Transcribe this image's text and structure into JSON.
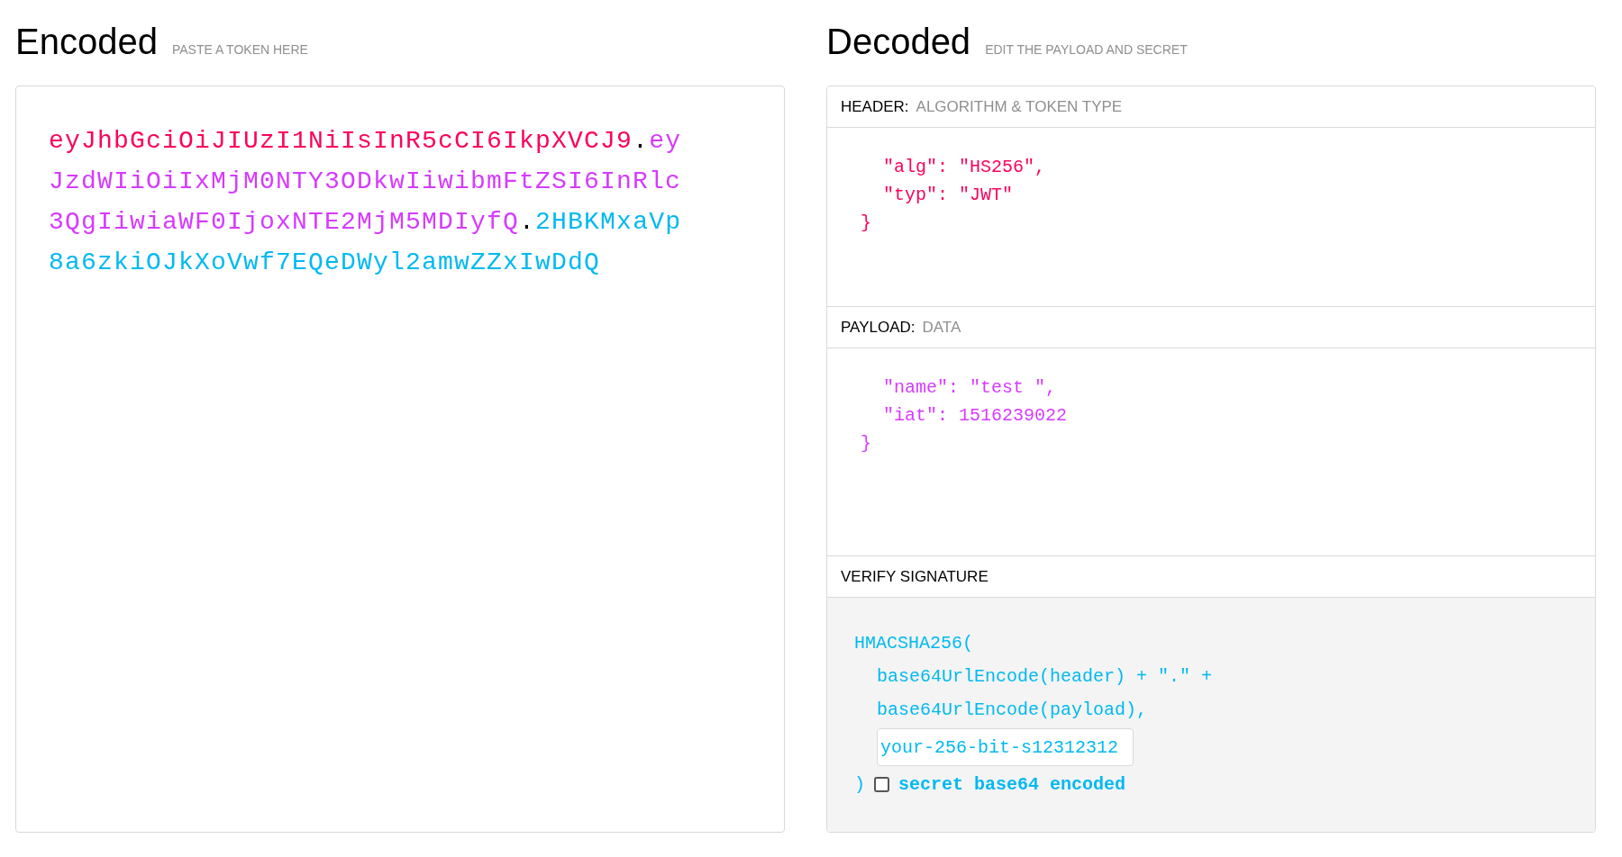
{
  "encoded": {
    "title": "Encoded",
    "subtitle": "PASTE A TOKEN HERE",
    "lines": [
      [
        {
          "text": "eyJhbGciOiJIUzI1NiIsInR5cCI6IkpXVCJ9",
          "kind": "header"
        },
        {
          "text": ".",
          "kind": "dot"
        },
        {
          "text": "ey",
          "kind": "payload"
        }
      ],
      [
        {
          "text": "JzdWIiOiIxMjM0NTY3ODkwIiwibmFtZSI6InRlc",
          "kind": "payload"
        }
      ],
      [
        {
          "text": "3QgIiwiaWF0IjoxNTE2MjM5MDIyfQ",
          "kind": "payload"
        },
        {
          "text": ".",
          "kind": "dot"
        },
        {
          "text": "2HBKMxaVp",
          "kind": "signature"
        }
      ],
      [
        {
          "text": "8a6zkiOJkXoVwf7EQeDWyl2amwZZxIwDdQ",
          "kind": "signature"
        }
      ]
    ]
  },
  "decoded": {
    "title": "Decoded",
    "subtitle": "EDIT THE PAYLOAD AND SECRET",
    "header": {
      "label": "HEADER:",
      "sublabel": "ALGORITHM & TOKEN TYPE",
      "fields": [
        "\"alg\": \"HS256\",",
        "\"typ\": \"JWT\""
      ],
      "closing": "}"
    },
    "payload": {
      "label": "PAYLOAD:",
      "sublabel": "DATA",
      "fields": [
        "\"name\": \"test \",",
        "\"iat\": 1516239022"
      ],
      "closing": "}"
    },
    "verify": {
      "label": "VERIFY SIGNATURE",
      "open": "HMACSHA256(",
      "args": [
        "base64UrlEncode(header) + \".\" +",
        "base64UrlEncode(payload),"
      ],
      "secret": "your-256-bit-s12312312",
      "close": ")",
      "base64_label": "secret base64 encoded",
      "base64_checked": false
    }
  }
}
